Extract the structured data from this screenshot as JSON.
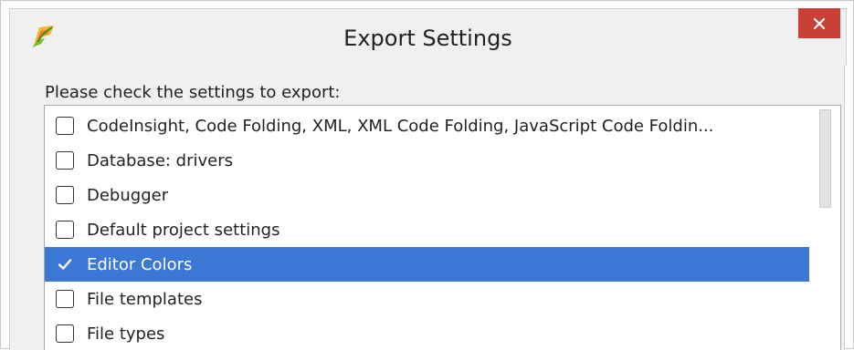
{
  "window": {
    "title": "Export Settings",
    "close_icon": "close-icon",
    "app_icon": "intellij-app-icon"
  },
  "dialog": {
    "prompt": "Please check the settings to export:",
    "items": [
      {
        "label": "CodeInsight, Code Folding, XML, XML Code Folding, JavaScript Code Foldin...",
        "checked": false,
        "selected": false
      },
      {
        "label": "Database: drivers",
        "checked": false,
        "selected": false
      },
      {
        "label": "Debugger",
        "checked": false,
        "selected": false
      },
      {
        "label": "Default project settings",
        "checked": false,
        "selected": false
      },
      {
        "label": "Editor Colors",
        "checked": true,
        "selected": true
      },
      {
        "label": "File templates",
        "checked": false,
        "selected": false
      },
      {
        "label": "File types",
        "checked": false,
        "selected": false
      }
    ]
  },
  "colors": {
    "selection": "#3b78d6",
    "close_button": "#c84036",
    "dialog_background": "#f0f0f0"
  }
}
